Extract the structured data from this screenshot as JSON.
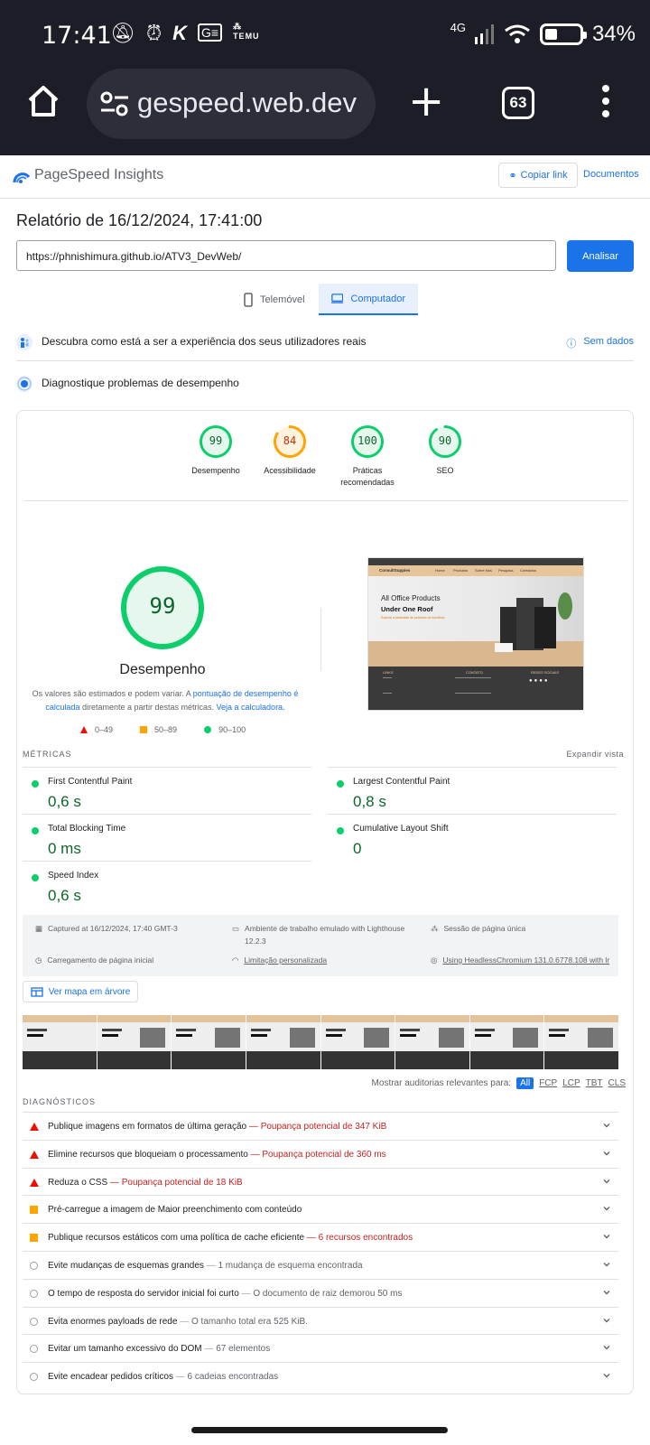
{
  "status_bar": {
    "time": "17:41",
    "network": "4G",
    "battery": "34%",
    "temu": "TEMU"
  },
  "browser": {
    "url_text": "gespeed.web.dev",
    "tab_count": "63",
    "new_tab": "+"
  },
  "psi": {
    "product_name": "PageSpeed Insights",
    "copy_link": "Copiar link",
    "docs": "Documentos",
    "report_title": "Relatório de 16/12/2024, 17:41:00",
    "url_value": "https://phnishimura.github.io/ATV3_DevWeb/",
    "analyze": "Analisar",
    "tabs": {
      "mobile": "Telemóvel",
      "desktop": "Computador"
    },
    "crux_text": "Descubra como está a ser a experiência dos seus utilizadores reais",
    "no_data": "Sem dados",
    "diag_text": "Diagnostique problemas de desempenho"
  },
  "scores": [
    {
      "label": "Desempenho",
      "value": "99",
      "pct": 0.99,
      "color": "#0cce6b",
      "text_color": "#0d652d",
      "bg": "#e6f7ed"
    },
    {
      "label": "Acessibilidade",
      "value": "84",
      "pct": 0.84,
      "color": "#ffa400",
      "text_color": "#c33300",
      "bg": "#fff3e0"
    },
    {
      "label": "Práticas recomendadas",
      "value": "100",
      "pct": 1.0,
      "color": "#0cce6b",
      "text_color": "#0d652d",
      "bg": "#e6f7ed"
    },
    {
      "label": "SEO",
      "value": "90",
      "pct": 0.9,
      "color": "#0cce6b",
      "text_color": "#0d652d",
      "bg": "#e6f7ed"
    }
  ],
  "perf": {
    "score": "99",
    "label": "Desempenho",
    "note_a": "Os valores são estimados e podem variar. A ",
    "note_link1": "pontuação de desempenho é calculada",
    "note_b": " diretamente a partir destas métricas. ",
    "note_link2": "Veja a calculadora.",
    "legend": [
      "0–49",
      "50–89",
      "90–100"
    ]
  },
  "preview": {
    "brand": "ConsultSuppies",
    "nav": [
      "Home",
      "Produtos",
      "Sobre Nós",
      "Pesquisa",
      "Contactos"
    ],
    "headline1": "All Office Products",
    "headline2": "Under One Roof",
    "tagline": "Explore a variedade de produtos de escritório",
    "footer_cols": [
      "LINKS",
      "CONTATO",
      "REDES SOCIAIS"
    ]
  },
  "metrics": {
    "section_label": "MÉTRICAS",
    "expand": "Expandir vista",
    "items": [
      {
        "name": "First Contentful Paint",
        "value": "0,6 s"
      },
      {
        "name": "Largest Contentful Paint",
        "value": "0,8 s"
      },
      {
        "name": "Total Blocking Time",
        "value": "0 ms"
      },
      {
        "name": "Cumulative Layout Shift",
        "value": "0"
      },
      {
        "name": "Speed Index",
        "value": "0,6 s"
      }
    ]
  },
  "environment": {
    "captured": "Captured at 16/12/2024, 17:40 GMT-3",
    "emulated": "Ambiente de trabalho emulado with Lighthouse",
    "lh_version": "12.2.3",
    "session": "Sessão de página única",
    "initial_load": "Carregamento de página inicial",
    "throttling": "Limitação personalizada",
    "browser": "Using HeadlessChromium 131.0.6778.108 with lr"
  },
  "tree_map": "Ver mapa em árvore",
  "audit_filter": {
    "label": "Mostrar auditorias relevantes para:",
    "chips": [
      "All",
      "FCP",
      "LCP",
      "TBT",
      "CLS"
    ]
  },
  "diagnostics": {
    "section_label": "DIAGNÓSTICOS",
    "items": [
      {
        "status": "fail",
        "title": "Publique imagens em formatos de última geração",
        "detail": "Poupança potencial de 347 KiB"
      },
      {
        "status": "fail",
        "title": "Elimine recursos que bloqueiam o processamento",
        "detail": "Poupança potencial de 360 ms"
      },
      {
        "status": "fail",
        "title": "Reduza o CSS",
        "detail": "Poupança potencial de 18 KiB"
      },
      {
        "status": "avg",
        "title": "Pré-carregue a imagem de Maior preenchimento com conteúdo",
        "detail": ""
      },
      {
        "status": "avg",
        "title": "Publique recursos estáticos com uma política de cache eficiente",
        "detail": "6 recursos encontrados"
      },
      {
        "status": "pass",
        "title": "Evite mudanças de esquemas grandes",
        "detail": "1 mudança de esquema encontrada"
      },
      {
        "status": "pass",
        "title": "O tempo de resposta do servidor inicial foi curto",
        "detail": "O documento de raiz demorou 50 ms"
      },
      {
        "status": "pass",
        "title": "Evita enormes payloads de rede",
        "detail": "O tamanho total era 525 KiB."
      },
      {
        "status": "pass",
        "title": "Evitar um tamanho excessivo do DOM",
        "detail": "67 elementos"
      },
      {
        "status": "pass",
        "title": "Evite encadear pedidos críticos",
        "detail": "6 cadeias encontradas"
      }
    ]
  }
}
